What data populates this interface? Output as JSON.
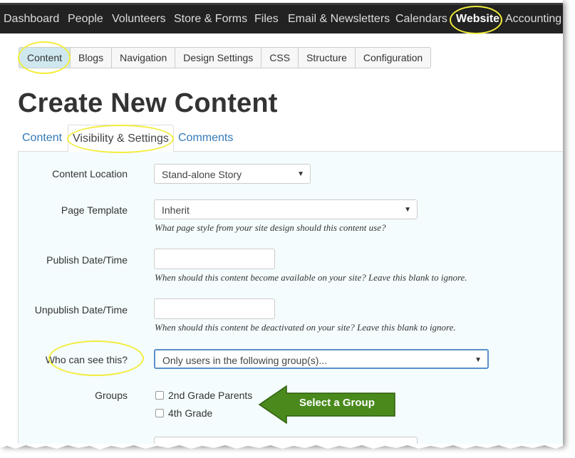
{
  "topnav": {
    "items": [
      "Dashboard",
      "People",
      "Volunteers",
      "Store & Forms",
      "Files",
      "Email & Newsletters",
      "Calendars",
      "Website",
      "Accounting"
    ],
    "active": "Website"
  },
  "subtabs": {
    "items": [
      "Content",
      "Blogs",
      "Navigation",
      "Design Settings",
      "CSS",
      "Structure",
      "Configuration"
    ],
    "active": "Content"
  },
  "page_title": "Create New Content",
  "content_tabs": {
    "items": [
      "Content",
      "Visibility & Settings",
      "Comments"
    ],
    "active": "Visibility & Settings"
  },
  "form": {
    "content_location": {
      "label": "Content Location",
      "value": "Stand-alone Story"
    },
    "page_template": {
      "label": "Page Template",
      "value": "Inherit",
      "help": "What page style from your site design should this content use?"
    },
    "publish_date": {
      "label": "Publish Date/Time",
      "value": "",
      "help": "When should this content become available on your site? Leave this blank to ignore."
    },
    "unpublish_date": {
      "label": "Unpublish Date/Time",
      "value": "",
      "help": "When should this content be deactivated on your site? Leave this blank to ignore."
    },
    "visibility": {
      "label": "Who can see this?",
      "value": "Only users in the following group(s)..."
    },
    "groups": {
      "label": "Groups",
      "options": [
        "2nd Grade Parents",
        "4th Grade"
      ]
    }
  },
  "callout": {
    "text": "Select a Group",
    "color": "#4a8a1c"
  },
  "colors": {
    "highlight_oval": "#f2ed3c",
    "nav_bg": "#222222",
    "link": "#337ab7",
    "panel_bg": "#f4fcfd"
  }
}
